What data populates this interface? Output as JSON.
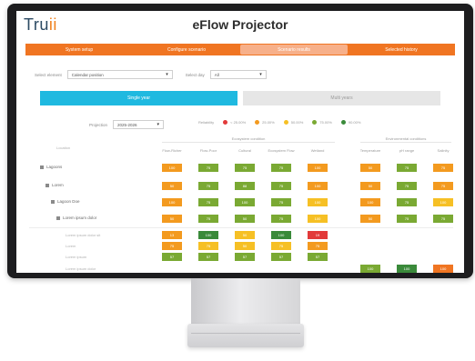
{
  "app": {
    "logo_main": "Tru",
    "logo_accent": "ii",
    "title": "eFlow Projector"
  },
  "nav": {
    "items": [
      {
        "label": "System setup",
        "active": false
      },
      {
        "label": "Configure scenario",
        "active": false
      },
      {
        "label": "Scenario results",
        "active": true
      },
      {
        "label": "Selected history",
        "active": false
      }
    ]
  },
  "filters": {
    "label1": "Select element",
    "value1": "Calendar position",
    "label2": "Select day",
    "value2": "All"
  },
  "tabs": {
    "primary": "Single year",
    "secondary": "Multi years"
  },
  "period": {
    "label": "Projection",
    "value": "2025-2026"
  },
  "legend": {
    "title": "Reliability",
    "items": [
      {
        "label": "< 25.00%",
        "color": "#e23a3a"
      },
      {
        "label": "25.00%",
        "color": "#f39a1f"
      },
      {
        "label": "50.00%",
        "color": "#f6c025"
      },
      {
        "label": "75.00%",
        "color": "#7aa933"
      },
      {
        "label": "90.00%",
        "color": "#3a8a3a"
      }
    ]
  },
  "groups": {
    "left": "Ecosystem condition",
    "right": "Environmental conditions"
  },
  "columns": {
    "left": [
      "Flow-Richer",
      "Flow-Poor",
      "Cultural",
      "Ecosystem Flow",
      "Wetland"
    ],
    "right": [
      "Temperature",
      "pH range",
      "Salinity"
    ]
  },
  "row_header": "Location",
  "rows": [
    {
      "label": "Lagoons",
      "indent": 0,
      "cells": [
        [
          "100",
          "#f39a1f"
        ],
        [
          "75",
          "#7aa933"
        ],
        [
          "75",
          "#7aa933"
        ],
        [
          "75",
          "#7aa933"
        ],
        [
          "100",
          "#f39a1f"
        ]
      ],
      "rcells": [
        [
          "50",
          "#f39a1f"
        ],
        [
          "75",
          "#7aa933"
        ],
        [
          "75",
          "#f39a1f"
        ]
      ]
    },
    {
      "label": "Lorem",
      "indent": 1,
      "cells": [
        [
          "50",
          "#f39a1f"
        ],
        [
          "75",
          "#7aa933"
        ],
        [
          "88",
          "#7aa933"
        ],
        [
          "75",
          "#7aa933"
        ],
        [
          "100",
          "#f39a1f"
        ]
      ],
      "rcells": [
        [
          "50",
          "#f39a1f"
        ],
        [
          "75",
          "#7aa933"
        ],
        [
          "75",
          "#f39a1f"
        ]
      ]
    },
    {
      "label": "Lagoon Doe",
      "indent": 2,
      "cells": [
        [
          "100",
          "#f39a1f"
        ],
        [
          "75",
          "#7aa933"
        ],
        [
          "100",
          "#7aa933"
        ],
        [
          "75",
          "#7aa933"
        ],
        [
          "100",
          "#f6c025"
        ]
      ],
      "rcells": [
        [
          "100",
          "#f39a1f"
        ],
        [
          "75",
          "#7aa933"
        ],
        [
          "100",
          "#f6c025"
        ]
      ]
    },
    {
      "label": "Lorem ipsum dolor",
      "indent": 3,
      "cells": [
        [
          "50",
          "#f39a1f"
        ],
        [
          "75",
          "#7aa933"
        ],
        [
          "50",
          "#7aa933"
        ],
        [
          "75",
          "#7aa933"
        ],
        [
          "100",
          "#f6c025"
        ]
      ],
      "rcells": [
        [
          "50",
          "#f39a1f"
        ],
        [
          "75",
          "#7aa933"
        ],
        [
          "75",
          "#7aa933"
        ]
      ]
    }
  ],
  "subrows": [
    {
      "label": "Lorem ipsum dolor sit",
      "cells": [
        [
          "13",
          "#f39a1f"
        ],
        [
          "100",
          "#3a8a3a"
        ],
        [
          "50",
          "#f6c025"
        ],
        [
          "100",
          "#3a8a3a"
        ],
        [
          "19",
          "#e23a3a"
        ]
      ]
    },
    {
      "label": "Lorem",
      "cells": [
        [
          "75",
          "#f39a1f"
        ],
        [
          "75",
          "#f6c025"
        ],
        [
          "50",
          "#f6c025"
        ],
        [
          "75",
          "#f6c025"
        ],
        [
          "75",
          "#f39a1f"
        ]
      ]
    },
    {
      "label": "Lorem ipsum",
      "cells": [
        [
          "57",
          "#7aa933"
        ],
        [
          "57",
          "#7aa933"
        ],
        [
          "57",
          "#7aa933"
        ],
        [
          "57",
          "#7aa933"
        ],
        [
          "57",
          "#7aa933"
        ]
      ]
    },
    {
      "label": "Lorem ipsum dolor",
      "cells": [],
      "rcells": [
        [
          "100",
          "#7aa933"
        ],
        [
          "100",
          "#3a8a3a"
        ],
        [
          "100",
          "#f07522"
        ]
      ]
    }
  ]
}
